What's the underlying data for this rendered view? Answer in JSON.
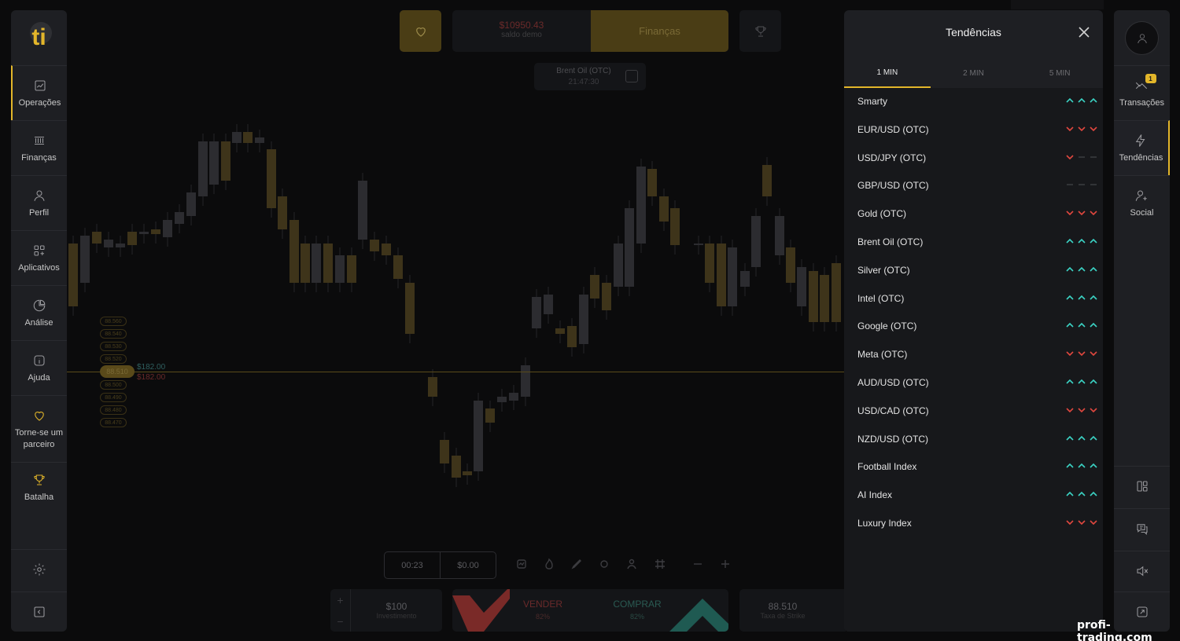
{
  "brand": {
    "logo_text": "ti",
    "accent": "#e3b62a"
  },
  "left_nav": [
    {
      "id": "operacoes",
      "label": "Operações",
      "icon": "chart-line-icon",
      "active": true
    },
    {
      "id": "financas",
      "label": "Finanças",
      "icon": "bank-icon"
    },
    {
      "id": "perfil",
      "label": "Perfil",
      "icon": "user-icon"
    },
    {
      "id": "aplicativos",
      "label": "Aplicativos",
      "icon": "apps-grid-icon"
    },
    {
      "id": "analise",
      "label": "Análise",
      "icon": "pie-chart-icon"
    },
    {
      "id": "ajuda",
      "label": "Ajuda",
      "icon": "info-icon"
    },
    {
      "id": "parceiro",
      "label": "Torne-se um parceiro",
      "icon": "heart-icon"
    },
    {
      "id": "batalha",
      "label": "Batalha",
      "icon": "trophy-icon"
    }
  ],
  "left_bottom": [
    {
      "icon": "gear-icon"
    },
    {
      "icon": "collapse-icon"
    }
  ],
  "header": {
    "balance": "$10950.43",
    "balance_label": "saldo demo",
    "finance_button": "Finanças",
    "asset": "Brent Oil (OTC)",
    "time": "21:47:30"
  },
  "chart": {
    "price_tag": "88.510",
    "level_up": "$182.00",
    "level_down": "$182.00",
    "scale_top": [
      "88.560",
      "88.540",
      "88.530",
      "88.520"
    ],
    "scale_bottom": [
      "88.500",
      "88.490",
      "88.480",
      "88.470"
    ]
  },
  "controls": {
    "timer": "00:23",
    "amount": "$0.00",
    "investment": "$100",
    "investment_label": "Investimento",
    "sell_label": "VENDER",
    "sell_pct": "82%",
    "buy_label": "COMPRAR",
    "buy_pct": "82%",
    "strike": "88.510",
    "strike_label": "Taxa de Strike"
  },
  "trends": {
    "title": "Tendências",
    "tabs": [
      "1 MIN",
      "2 MIN",
      "5 MIN"
    ],
    "active_tab": "1 MIN",
    "colors": {
      "up": "#3bd3c4",
      "down": "#e0473f",
      "neutral": "#3a3b3f"
    },
    "items": [
      {
        "name": "Smarty",
        "arrows": [
          "up",
          "up",
          "up"
        ]
      },
      {
        "name": "EUR/USD (OTC)",
        "arrows": [
          "down",
          "down",
          "down"
        ]
      },
      {
        "name": "USD/JPY (OTC)",
        "arrows": [
          "down",
          "neutral",
          "neutral"
        ]
      },
      {
        "name": "GBP/USD (OTC)",
        "arrows": [
          "neutral",
          "neutral",
          "neutral"
        ]
      },
      {
        "name": "Gold (OTC)",
        "arrows": [
          "down",
          "down",
          "down"
        ]
      },
      {
        "name": "Brent Oil (OTC)",
        "arrows": [
          "up",
          "up",
          "up"
        ]
      },
      {
        "name": "Silver (OTC)",
        "arrows": [
          "up",
          "up",
          "up"
        ]
      },
      {
        "name": "Intel (OTC)",
        "arrows": [
          "up",
          "up",
          "up"
        ]
      },
      {
        "name": "Google (OTC)",
        "arrows": [
          "up",
          "up",
          "up"
        ]
      },
      {
        "name": "Meta (OTC)",
        "arrows": [
          "down",
          "down",
          "down"
        ]
      },
      {
        "name": "AUD/USD (OTC)",
        "arrows": [
          "up",
          "up",
          "up"
        ]
      },
      {
        "name": "USD/CAD (OTC)",
        "arrows": [
          "down",
          "down",
          "down"
        ]
      },
      {
        "name": "NZD/USD (OTC)",
        "arrows": [
          "up",
          "up",
          "up"
        ]
      },
      {
        "name": "Football Index",
        "arrows": [
          "up",
          "up",
          "up"
        ]
      },
      {
        "name": "AI Index",
        "arrows": [
          "up",
          "up",
          "up"
        ]
      },
      {
        "name": "Luxury Index",
        "arrows": [
          "down",
          "down",
          "down"
        ]
      }
    ]
  },
  "right_nav": [
    {
      "id": "transacoes",
      "label": "Transações",
      "icon": "transactions-icon",
      "badge": "1"
    },
    {
      "id": "tendencias",
      "label": "Tendências",
      "icon": "lightning-icon",
      "active": true
    },
    {
      "id": "social",
      "label": "Social",
      "icon": "add-user-icon"
    }
  ],
  "right_bottom": [
    {
      "icon": "layout-icon"
    },
    {
      "icon": "chat-icon"
    },
    {
      "icon": "sound-off-icon"
    },
    {
      "icon": "fullscreen-icon"
    }
  ],
  "watermark": "profi-trading.com"
}
